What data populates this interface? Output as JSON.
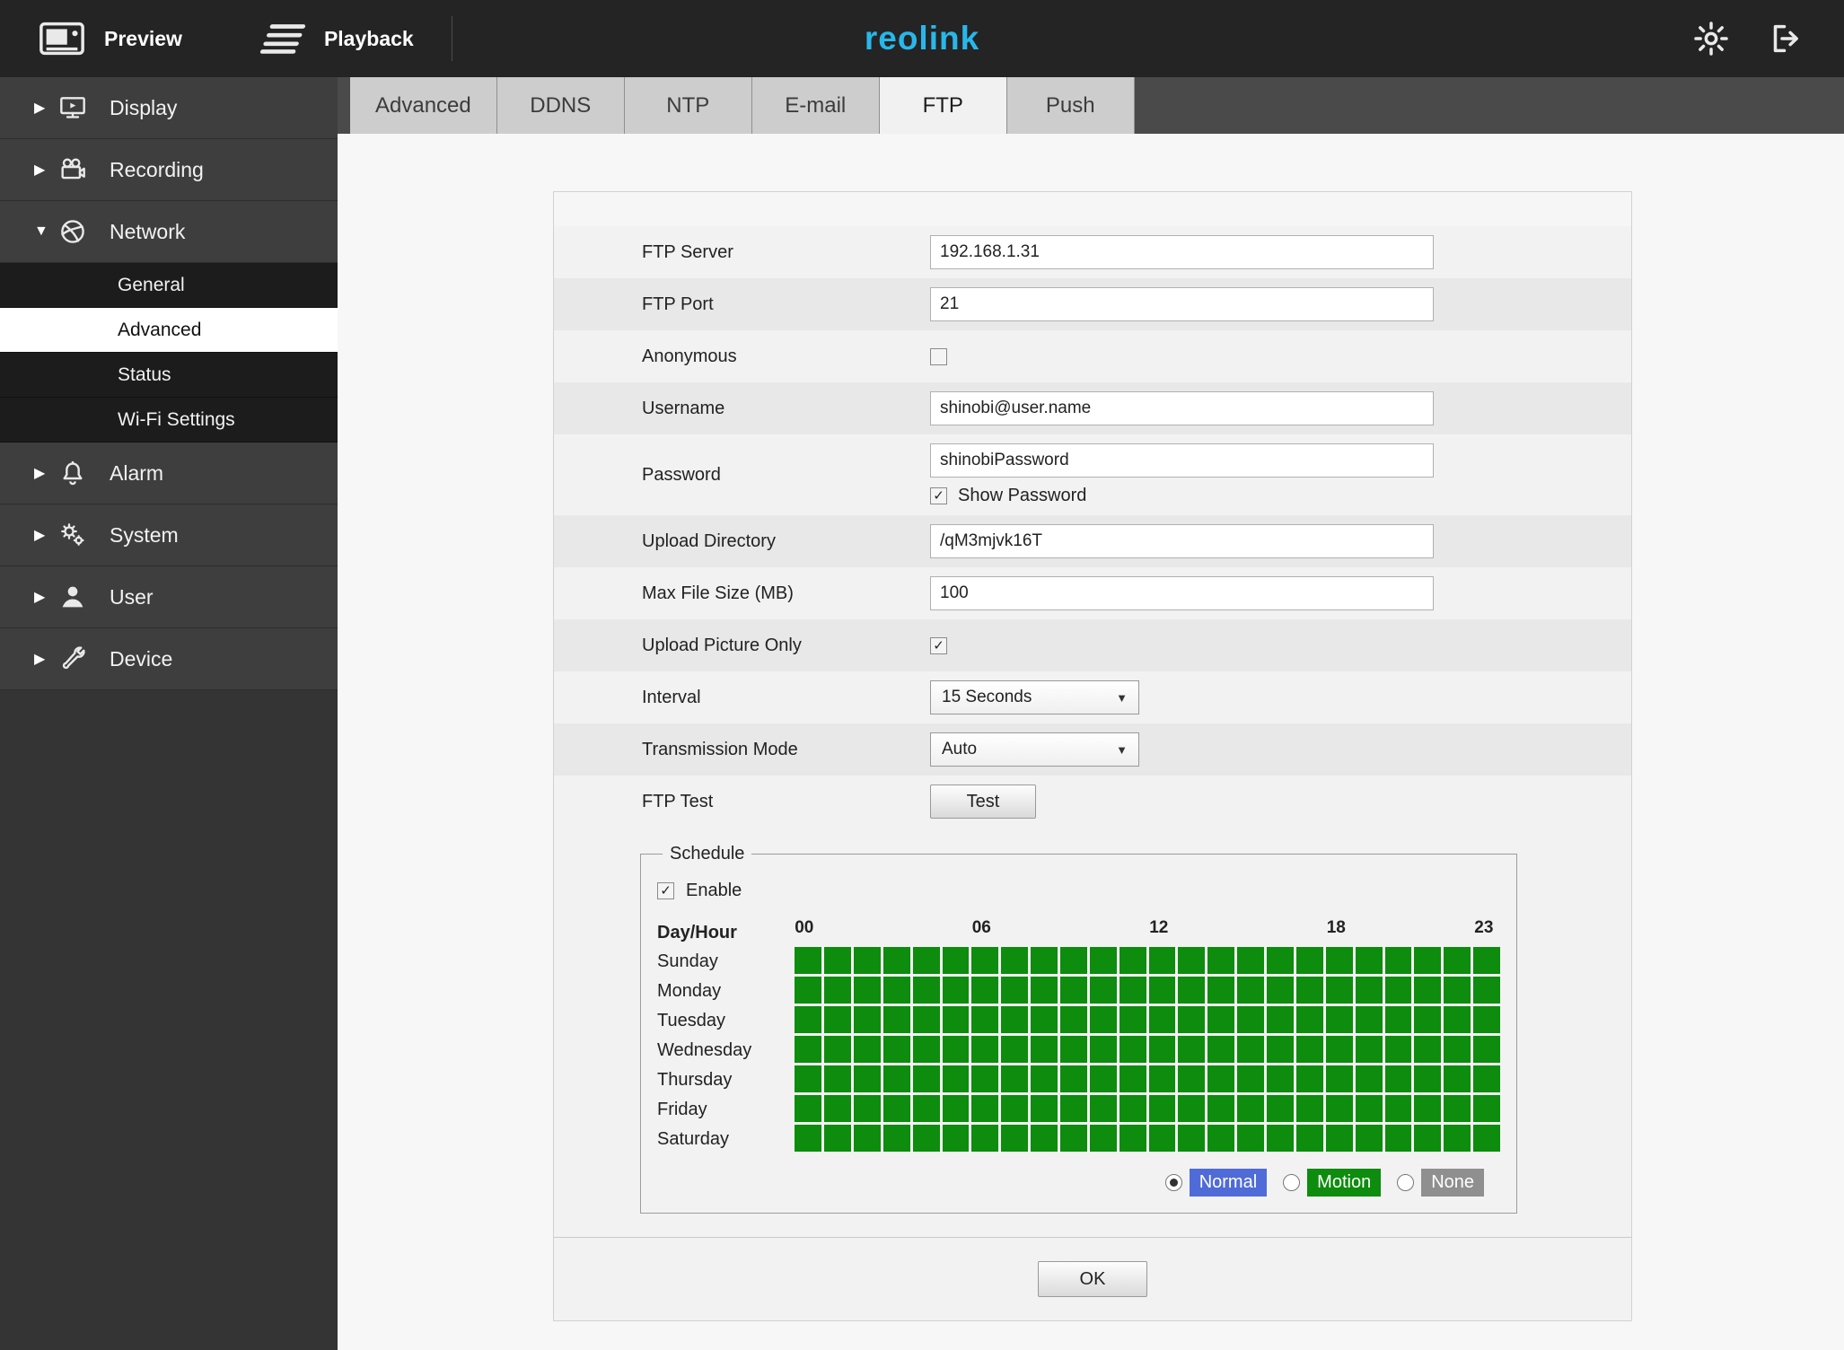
{
  "topbar": {
    "preview_label": "Preview",
    "playback_label": "Playback",
    "logo_re": "re",
    "logo_o": "o",
    "logo_link": "link",
    "logo_color": "#29b7ea"
  },
  "icons": {
    "chevron_collapsed": "▶",
    "chevron_expanded": "▼",
    "checkmark": "✓",
    "select_arrow": "▼"
  },
  "sidebar": {
    "items": [
      {
        "label": "Display",
        "expanded": false
      },
      {
        "label": "Recording",
        "expanded": false
      },
      {
        "label": "Network",
        "expanded": true,
        "children": [
          {
            "label": "General",
            "active": false
          },
          {
            "label": "Advanced",
            "active": true
          },
          {
            "label": "Status",
            "active": false
          },
          {
            "label": "Wi-Fi Settings",
            "active": false
          }
        ]
      },
      {
        "label": "Alarm",
        "expanded": false
      },
      {
        "label": "System",
        "expanded": false
      },
      {
        "label": "User",
        "expanded": false
      },
      {
        "label": "Device",
        "expanded": false
      }
    ]
  },
  "tabs": [
    {
      "label": "Advanced",
      "active": false
    },
    {
      "label": "DDNS",
      "active": false
    },
    {
      "label": "NTP",
      "active": false
    },
    {
      "label": "E-mail",
      "active": false
    },
    {
      "label": "FTP",
      "active": true
    },
    {
      "label": "Push",
      "active": false
    }
  ],
  "form": {
    "ftp_server": {
      "label": "FTP Server",
      "value": "192.168.1.31"
    },
    "ftp_port": {
      "label": "FTP Port",
      "value": "21"
    },
    "anonymous": {
      "label": "Anonymous",
      "checked": false
    },
    "username": {
      "label": "Username",
      "value": "shinobi@user.name"
    },
    "password": {
      "label": "Password",
      "value": "shinobiPassword",
      "show_password_label": "Show Password",
      "show_password_checked": true
    },
    "upload_directory": {
      "label": "Upload Directory",
      "value": "/qM3mjvk16T"
    },
    "max_file_size": {
      "label": "Max File Size (MB)",
      "value": "100"
    },
    "upload_picture_only": {
      "label": "Upload Picture Only",
      "checked": true
    },
    "interval": {
      "label": "Interval",
      "value": "15 Seconds"
    },
    "transmission_mode": {
      "label": "Transmission Mode",
      "value": "Auto"
    },
    "ftp_test": {
      "label": "FTP Test",
      "button_label": "Test"
    }
  },
  "schedule": {
    "legend": "Schedule",
    "enable_label": "Enable",
    "enable_checked": true,
    "day_hour_label": "Day/Hour",
    "hour_labels": [
      "00",
      "06",
      "12",
      "18",
      "23"
    ],
    "hours": 24,
    "days": [
      "Sunday",
      "Monday",
      "Tuesday",
      "Wednesday",
      "Thursday",
      "Friday",
      "Saturday"
    ],
    "cell_color": "#0d8c0d",
    "all_cells_active": true,
    "modes": [
      {
        "label": "Normal",
        "color": "#4f6bd8",
        "selected": true
      },
      {
        "label": "Motion",
        "color": "#0d8c0d",
        "selected": false
      },
      {
        "label": "None",
        "color": "#8f8f8f",
        "selected": false
      }
    ]
  },
  "ok_button": "OK"
}
